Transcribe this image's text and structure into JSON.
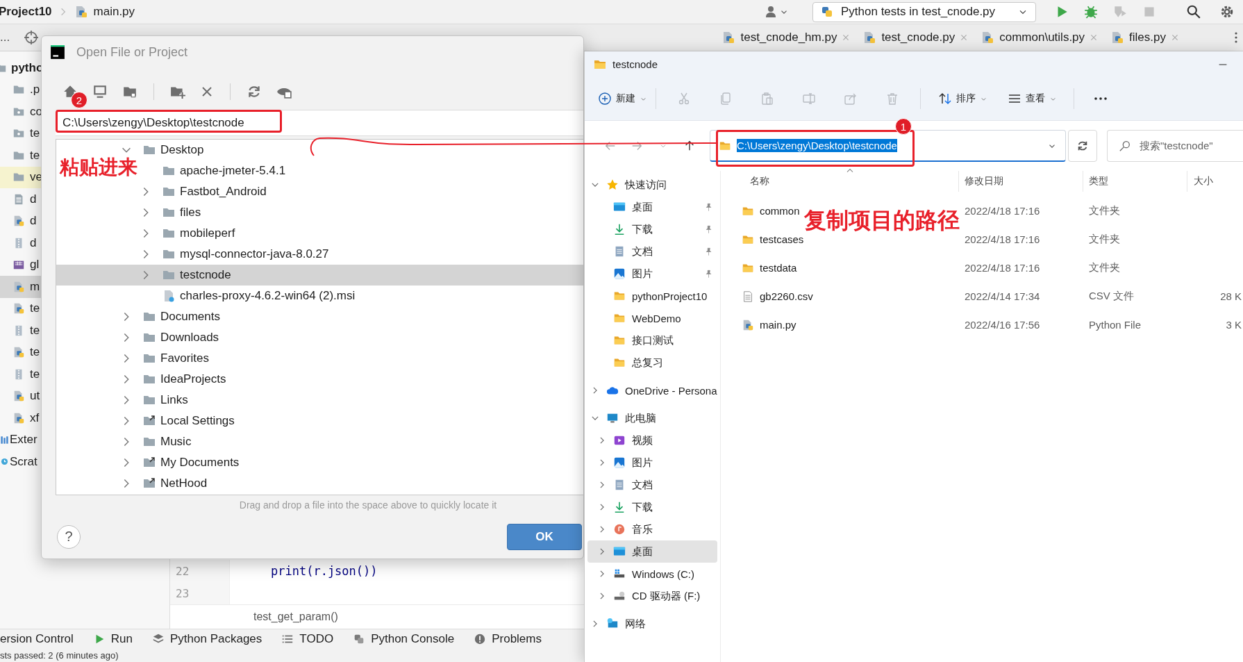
{
  "ide": {
    "project": "Project10",
    "file": "main.py",
    "run_config": "Python tests in test_cnode.py",
    "run_controls": [
      {
        "kind": "run",
        "disabled": false
      },
      {
        "kind": "debug",
        "disabled": false
      },
      {
        "kind": "coverage",
        "disabled": true
      },
      {
        "kind": "stop",
        "disabled": true
      }
    ],
    "panel_menu": "...",
    "editor_tabs": [
      {
        "label": "test_cnode_hm.py"
      },
      {
        "label": "test_cnode.py"
      },
      {
        "label": "common\\utils.py"
      },
      {
        "label": "files.py"
      }
    ],
    "project_tree": {
      "root": "pytho",
      "items": [
        {
          "label": ".p",
          "kind": "folder",
          "selected": false,
          "highlighted": false
        },
        {
          "label": "co",
          "kind": "package",
          "selected": false,
          "highlighted": false
        },
        {
          "label": "te",
          "kind": "package",
          "selected": false,
          "highlighted": false
        },
        {
          "label": "te",
          "kind": "folder",
          "selected": false,
          "highlighted": false
        },
        {
          "label": "ve",
          "kind": "folder",
          "selected": false,
          "highlighted": true
        },
        {
          "label": "d",
          "kind": "text",
          "selected": false,
          "highlighted": false
        },
        {
          "label": "d",
          "kind": "python",
          "selected": false,
          "highlighted": false
        },
        {
          "label": "d",
          "kind": "archive",
          "selected": false,
          "highlighted": false
        },
        {
          "label": "gl",
          "kind": "csv",
          "selected": false,
          "highlighted": false
        },
        {
          "label": "m",
          "kind": "python",
          "selected": true,
          "highlighted": false
        },
        {
          "label": "te",
          "kind": "python",
          "selected": false,
          "highlighted": false
        },
        {
          "label": "te",
          "kind": "archive",
          "selected": false,
          "highlighted": false
        },
        {
          "label": "te",
          "kind": "python",
          "selected": false,
          "highlighted": false
        },
        {
          "label": "te",
          "kind": "archive",
          "selected": false,
          "highlighted": false
        },
        {
          "label": "ut",
          "kind": "python",
          "selected": false,
          "highlighted": false
        },
        {
          "label": "xf",
          "kind": "python",
          "selected": false,
          "highlighted": false
        },
        {
          "label": "Exter",
          "kind": "library",
          "selected": false,
          "highlighted": false
        },
        {
          "label": "Scrat",
          "kind": "scratch",
          "selected": false,
          "highlighted": false
        }
      ]
    },
    "code_lines": [
      {
        "number": "22",
        "code": "print(r.json())"
      },
      {
        "number": "23"
      }
    ],
    "breadcrumb": "test_get_param()",
    "tool_windows": [
      {
        "label": "ersion Control",
        "kind": "none"
      },
      {
        "label": "Run",
        "kind": "run"
      },
      {
        "label": "Python Packages",
        "kind": "packages"
      },
      {
        "label": "TODO",
        "kind": "todo"
      },
      {
        "label": "Python Console",
        "kind": "console"
      },
      {
        "label": "Problems",
        "kind": "problems"
      }
    ],
    "status": "sts passed: 2 (6 minutes ago)"
  },
  "dialog": {
    "title": "Open File or Project",
    "path": "C:\\Users\\zengy\\Desktop\\testcnode",
    "tree": [
      {
        "label": "Desktop",
        "kind": "folder",
        "expanded": true,
        "selected": false,
        "children": [
          {
            "label": "apache-jmeter-5.4.1",
            "kind": "folder",
            "selected": false
          },
          {
            "label": "Fastbot_Android",
            "kind": "folder",
            "expanded": false,
            "selected": false
          },
          {
            "label": "files",
            "kind": "folder",
            "expanded": false,
            "selected": false
          },
          {
            "label": "mobileperf",
            "kind": "folder",
            "expanded": false,
            "selected": false
          },
          {
            "label": "mysql-connector-java-8.0.27",
            "kind": "folder",
            "expanded": false,
            "selected": false
          },
          {
            "label": "testcnode",
            "kind": "folder",
            "expanded": false,
            "selected": true
          },
          {
            "label": "charles-proxy-4.6.2-win64 (2).msi",
            "kind": "file",
            "selected": false
          }
        ]
      },
      {
        "label": "Documents",
        "kind": "folder",
        "expanded": false,
        "selected": false
      },
      {
        "label": "Downloads",
        "kind": "folder",
        "expanded": false,
        "selected": false
      },
      {
        "label": "Favorites",
        "kind": "folder",
        "expanded": false,
        "selected": false
      },
      {
        "label": "IdeaProjects",
        "kind": "folder",
        "expanded": false,
        "selected": false
      },
      {
        "label": "Links",
        "kind": "folder",
        "expanded": false,
        "selected": false
      },
      {
        "label": "Local Settings",
        "kind": "link",
        "expanded": false,
        "selected": false
      },
      {
        "label": "Music",
        "kind": "folder",
        "expanded": false,
        "selected": false
      },
      {
        "label": "My Documents",
        "kind": "link",
        "expanded": false,
        "selected": false
      },
      {
        "label": "NetHood",
        "kind": "link",
        "expanded": false,
        "selected": false
      }
    ],
    "hint": "Drag and drop a file into the space above to quickly locate it",
    "help": "?",
    "ok": "OK",
    "annotation": {
      "badge": "2",
      "note": "粘贴进来"
    }
  },
  "explorer": {
    "title": "testcnode",
    "toolbar": [
      {
        "kind": "new",
        "label": "新建",
        "disabled": false
      },
      {
        "kind": "cut",
        "disabled": true
      },
      {
        "kind": "copy",
        "disabled": true
      },
      {
        "kind": "paste",
        "disabled": true
      },
      {
        "kind": "rename",
        "disabled": true
      },
      {
        "kind": "share",
        "disabled": true
      },
      {
        "kind": "delete",
        "disabled": true
      },
      {
        "kind": "sort",
        "label": "排序",
        "disabled": false
      },
      {
        "kind": "view",
        "label": "查看",
        "disabled": false
      },
      {
        "kind": "more",
        "disabled": false
      }
    ],
    "address": {
      "value": "C:\\Users\\zengy\\Desktop\\testcnode",
      "selected": true
    },
    "search": {
      "placeholder": "搜索\"testcnode\""
    },
    "nav": [
      {
        "label": "快速访问",
        "kind": "star",
        "expanded": true,
        "selected": false,
        "children": [
          {
            "label": "桌面",
            "kind": "desktop",
            "pinned": true,
            "selected": false
          },
          {
            "label": "下载",
            "kind": "download",
            "pinned": true,
            "selected": false
          },
          {
            "label": "文档",
            "kind": "document",
            "pinned": true,
            "selected": false
          },
          {
            "label": "图片",
            "kind": "picture",
            "pinned": true,
            "selected": false
          },
          {
            "label": "pythonProject10",
            "kind": "folder",
            "pinned": false,
            "selected": false
          },
          {
            "label": "WebDemo",
            "kind": "folder",
            "pinned": false,
            "selected": false
          },
          {
            "label": "接口测试",
            "kind": "folder",
            "pinned": false,
            "selected": false
          },
          {
            "label": "总复习",
            "kind": "folder",
            "pinned": false,
            "selected": false
          }
        ]
      },
      {
        "label": "OneDrive - Persona",
        "kind": "cloud",
        "expanded": false,
        "selected": false
      },
      {
        "label": "此电脑",
        "kind": "pc",
        "expanded": true,
        "selected": false,
        "children": [
          {
            "label": "视频",
            "kind": "video",
            "expanded": false,
            "selected": false
          },
          {
            "label": "图片",
            "kind": "picture",
            "expanded": false,
            "selected": false
          },
          {
            "label": "文档",
            "kind": "document",
            "expanded": false,
            "selected": false
          },
          {
            "label": "下载",
            "kind": "download",
            "expanded": false,
            "selected": false
          },
          {
            "label": "音乐",
            "kind": "music",
            "expanded": false,
            "selected": false
          },
          {
            "label": "桌面",
            "kind": "desktop",
            "expanded": false,
            "selected": true
          },
          {
            "label": "Windows  (C:)",
            "kind": "drive",
            "expanded": false,
            "selected": false
          },
          {
            "label": "CD 驱动器 (F:)",
            "kind": "cd",
            "expanded": false,
            "selected": false
          }
        ]
      },
      {
        "label": "网络",
        "kind": "network",
        "expanded": false,
        "selected": false
      }
    ],
    "columns": [
      "名称",
      "修改日期",
      "类型",
      "大小"
    ],
    "files": [
      {
        "name": "common",
        "date": "2022/4/18 17:16",
        "type": "文件夹",
        "kind": "folder"
      },
      {
        "name": "testcases",
        "date": "2022/4/18 17:16",
        "type": "文件夹",
        "kind": "folder"
      },
      {
        "name": "testdata",
        "date": "2022/4/18 17:16",
        "type": "文件夹",
        "kind": "folder"
      },
      {
        "name": "gb2260.csv",
        "date": "2022/4/14 17:34",
        "type": "CSV 文件",
        "size": "28 K",
        "kind": "csv"
      },
      {
        "name": "main.py",
        "date": "2022/4/16 17:56",
        "type": "Python File",
        "size": "3 K",
        "kind": "python"
      }
    ],
    "annotation": {
      "badge": "1",
      "note": "复制项目的路径"
    }
  }
}
